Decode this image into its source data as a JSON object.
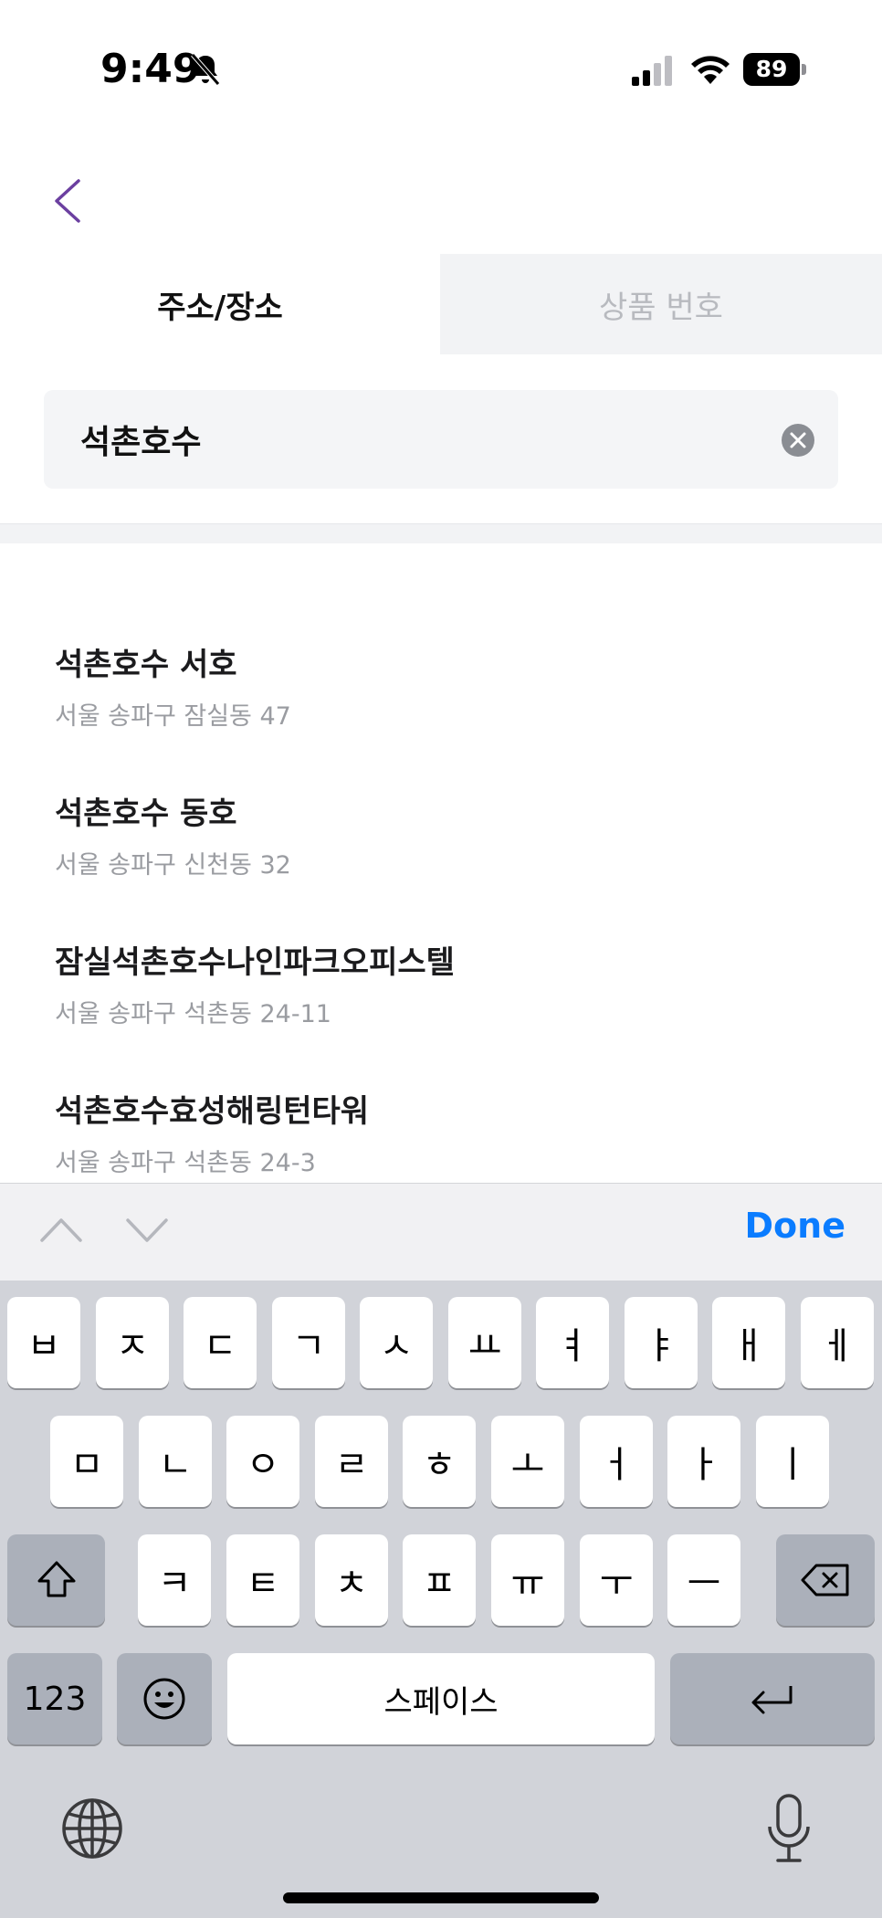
{
  "status_bar": {
    "time": "9:49",
    "battery": "89",
    "icons": [
      "bell-slash-icon",
      "cellular-signal-icon",
      "wifi-icon",
      "battery-icon"
    ]
  },
  "nav": {
    "back_icon": "chevron-left-icon"
  },
  "tabs": [
    {
      "label": "주소/장소",
      "active": true
    },
    {
      "label": "상품 번호",
      "active": false
    }
  ],
  "search": {
    "value": "석촌호수",
    "clear_icon": "clear-x-icon"
  },
  "results": [
    {
      "name": "석촌호수 서호",
      "address": "서울 송파구 잠실동 47"
    },
    {
      "name": "석촌호수 동호",
      "address": "서울 송파구 신천동 32"
    },
    {
      "name": "잠실석촌호수나인파크오피스텔",
      "address": "서울 송파구 석촌동 24-11"
    },
    {
      "name": "석촌호수효성해링턴타워",
      "address": "서울 송파구 석촌동 24-3"
    }
  ],
  "accessory_bar": {
    "done_label": "Done"
  },
  "keyboard": {
    "row1": [
      "ㅂ",
      "ㅈ",
      "ㄷ",
      "ㄱ",
      "ㅅ",
      "ㅛ",
      "ㅕ",
      "ㅑ",
      "ㅐ",
      "ㅔ"
    ],
    "row2": [
      "ㅁ",
      "ㄴ",
      "ㅇ",
      "ㄹ",
      "ㅎ",
      "ㅗ",
      "ㅓ",
      "ㅏ",
      "ㅣ"
    ],
    "row3": [
      "ㅋ",
      "ㅌ",
      "ㅊ",
      "ㅍ",
      "ㅠ",
      "ㅜ",
      "ㅡ"
    ],
    "numbers_label": "123",
    "space_label": "스페이스",
    "special_icons": [
      "shift-icon",
      "backspace-icon",
      "emoji-icon",
      "return-icon",
      "globe-icon",
      "microphone-icon"
    ]
  },
  "colors": {
    "accent": "#0a7cff",
    "back_chevron": "#6b3fa0",
    "keyboard_bg": "#d1d3d9",
    "tab_inactive_bg": "#f2f3f5"
  }
}
